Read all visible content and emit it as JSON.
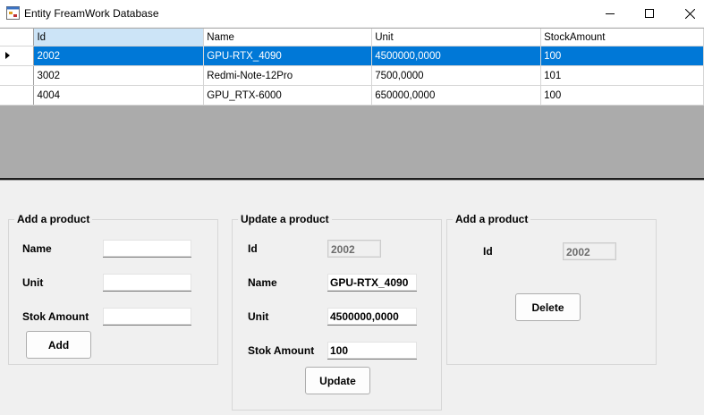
{
  "window": {
    "title": "Entity FreamWork Database"
  },
  "grid": {
    "columns": [
      "Id",
      "Name",
      "Unit",
      "StockAmount"
    ],
    "rows": [
      {
        "id": "2002",
        "name": "GPU-RTX_4090",
        "unit": "4500000,0000",
        "stock": "100"
      },
      {
        "id": "3002",
        "name": "Redmi-Note-12Pro",
        "unit": "7500,0000",
        "stock": "101"
      },
      {
        "id": "4004",
        "name": "GPU_RTX-6000",
        "unit": "650000,0000",
        "stock": "100"
      }
    ]
  },
  "add_group": {
    "title": "Add a product",
    "name_label": "Name",
    "unit_label": "Unit",
    "stock_label": "Stok Amount",
    "name_value": "",
    "unit_value": "",
    "stock_value": "",
    "button": "Add"
  },
  "update_group": {
    "title": "Update a product",
    "id_label": "Id",
    "id_value": "2002",
    "name_label": "Name",
    "name_value": "GPU-RTX_4090",
    "unit_label": "Unit",
    "unit_value": "4500000,0000",
    "stock_label": "Stok Amount",
    "stock_value": "100",
    "button": "Update"
  },
  "delete_group": {
    "title": "Add a product",
    "id_label": "Id",
    "id_value": "2002",
    "button": "Delete"
  },
  "colors": {
    "selection": "#0078d7",
    "header_selected": "#cce4f7",
    "grid_background": "#ababab"
  }
}
